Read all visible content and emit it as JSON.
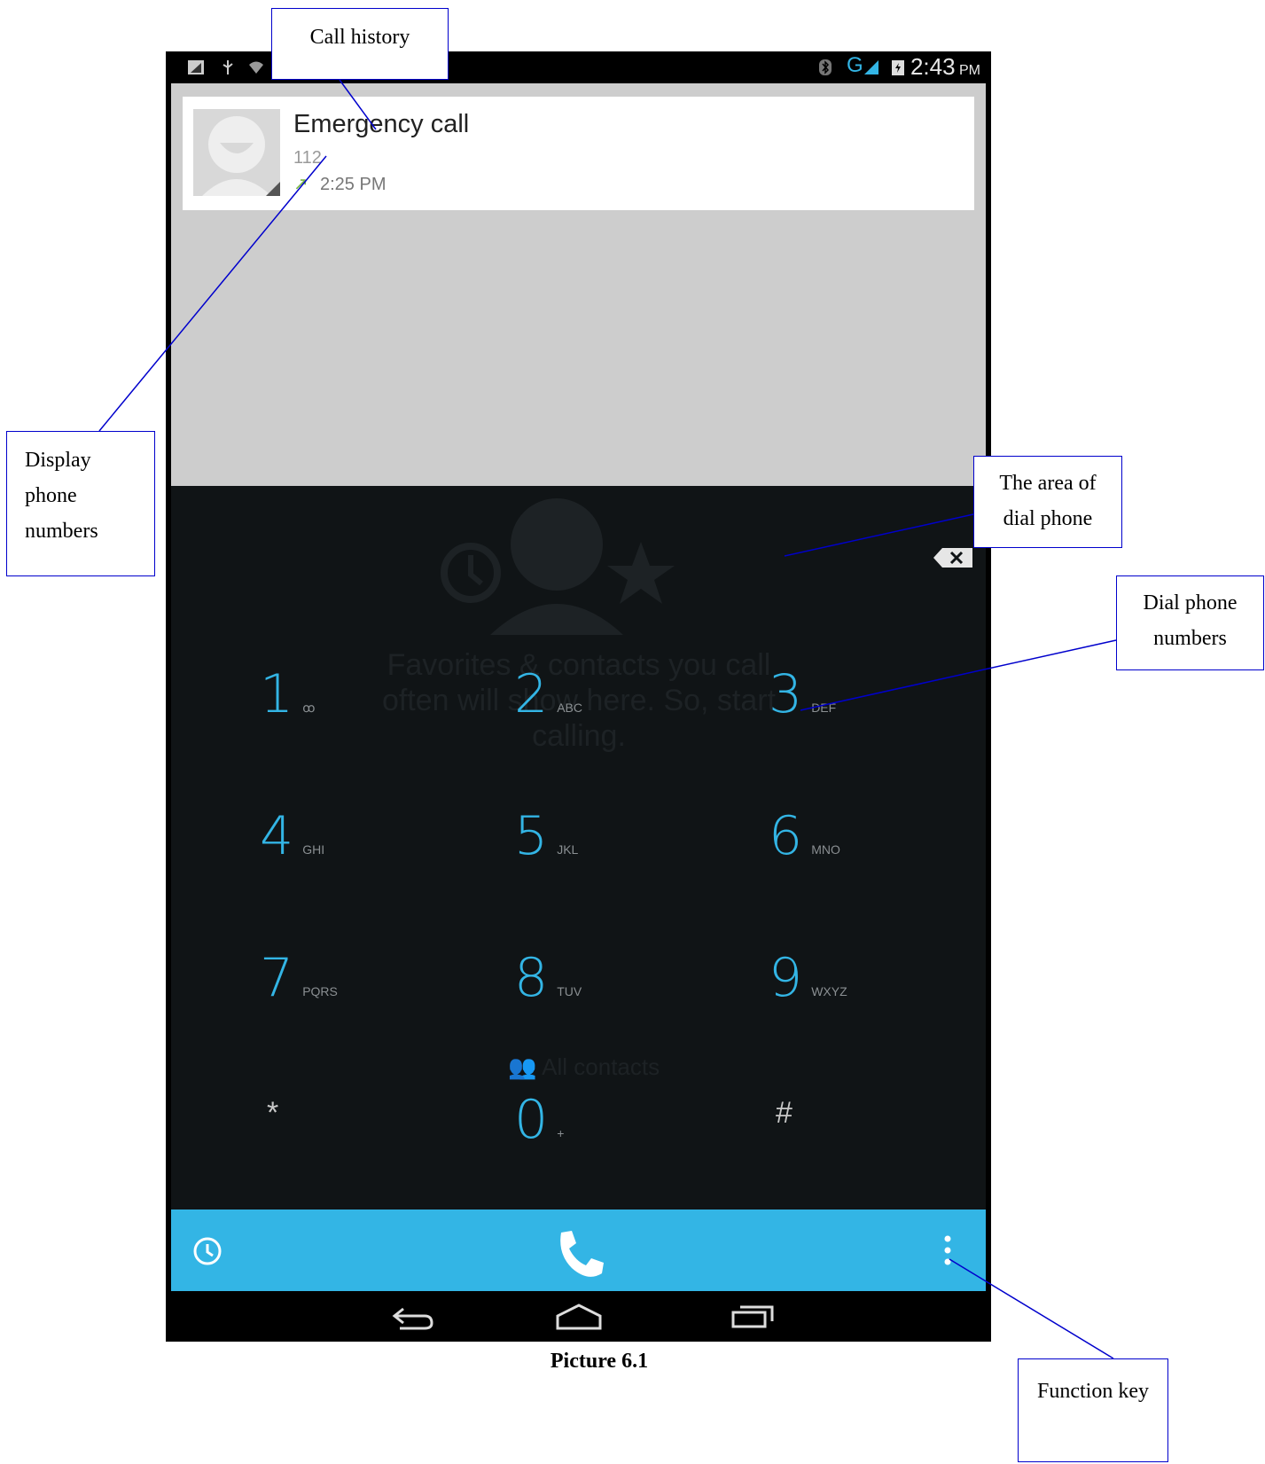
{
  "status_bar": {
    "time": "2:43",
    "ampm": "PM",
    "network": "G"
  },
  "call_history": {
    "name": "Emergency call",
    "number": "112",
    "time": "2:25 PM"
  },
  "dialer": {
    "empty_message": "Favorites & contacts you call often will show here. So, start calling.",
    "all_contacts": "All contacts",
    "keys": [
      {
        "digit": "1",
        "letters": "ꝏ"
      },
      {
        "digit": "2",
        "letters": "ABC"
      },
      {
        "digit": "3",
        "letters": "DEF"
      },
      {
        "digit": "4",
        "letters": "GHI"
      },
      {
        "digit": "5",
        "letters": "JKL"
      },
      {
        "digit": "6",
        "letters": "MNO"
      },
      {
        "digit": "7",
        "letters": "PQRS"
      },
      {
        "digit": "8",
        "letters": "TUV"
      },
      {
        "digit": "9",
        "letters": "WXYZ"
      },
      {
        "digit": "*",
        "letters": ""
      },
      {
        "digit": "0",
        "letters": "+"
      },
      {
        "digit": "#",
        "letters": ""
      }
    ]
  },
  "annotations": {
    "call_history": "Call history",
    "display_phone_numbers": "Display phone numbers",
    "area_of_dial_phone": "The area of dial phone",
    "dial_phone_numbers": "Dial phone numbers",
    "function_key": "Function key"
  },
  "caption": "Picture 6.1",
  "colors": {
    "accent": "#33b5e5",
    "dial_bg": "#101416",
    "history_bg": "#cdcdcd",
    "annotation_line": "#0000cc"
  }
}
